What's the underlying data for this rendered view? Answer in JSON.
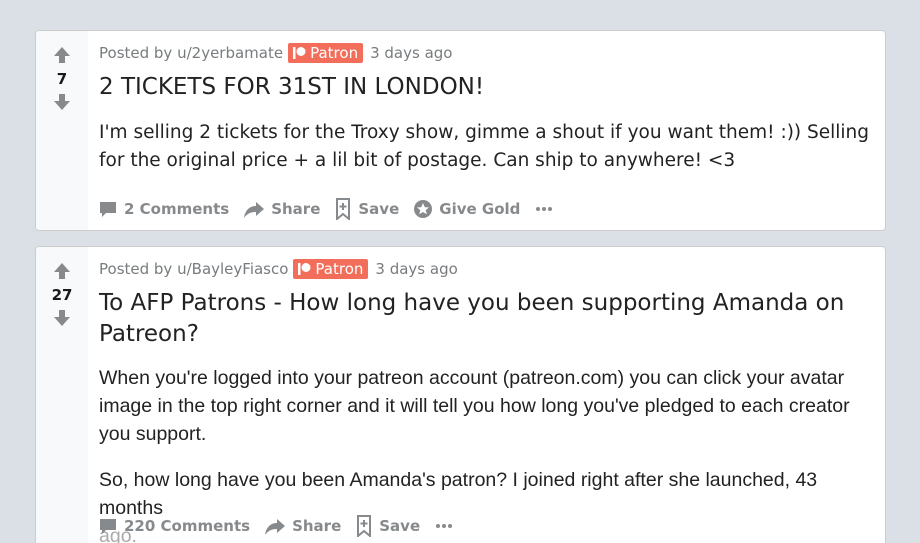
{
  "colors": {
    "background": "#dae0e6",
    "flair": "#f26e5a",
    "meta_text": "#787c7e",
    "action_text": "#878a8c"
  },
  "posts": [
    {
      "score": "7",
      "posted_by_prefix": "Posted by",
      "author": "u/2yerbamate",
      "flair": "Patron",
      "time": "3 days ago",
      "title": "2 TICKETS FOR 31ST IN LONDON!",
      "body": [
        "I'm selling 2 tickets for the Troxy show, gimme a shout if you want them! :)) Selling for the original price + a lil bit of postage. Can ship to anywhere! <3"
      ],
      "actions": {
        "comments": "2 Comments",
        "share": "Share",
        "save": "Save",
        "give_gold": "Give Gold"
      },
      "icons": [
        "upvote-icon",
        "downvote-icon",
        "patreon-icon",
        "comment-icon",
        "share-icon",
        "save-icon",
        "gold-icon",
        "more-icon"
      ]
    },
    {
      "score": "27",
      "posted_by_prefix": "Posted by",
      "author": "u/BayleyFiasco",
      "flair": "Patron",
      "time": "3 days ago",
      "title": "To AFP Patrons - How long have you been supporting Amanda on Patreon?",
      "body": [
        "When you're logged into your patreon account (patreon.com) you can click your avatar image in the top right corner and it will tell you how long you've pledged to each creator you support.",
        "So, how long have you been Amanda's patron? I joined right after she launched, 43 months",
        "ago."
      ],
      "actions": {
        "comments": "220 Comments",
        "share": "Share",
        "save": "Save"
      },
      "icons": [
        "upvote-icon",
        "downvote-icon",
        "patreon-icon",
        "comment-icon",
        "share-icon",
        "save-icon",
        "more-icon"
      ]
    }
  ]
}
